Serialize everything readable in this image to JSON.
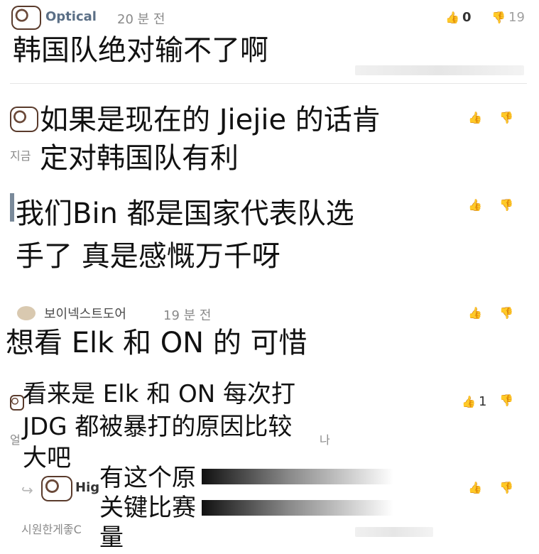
{
  "comments": [
    {
      "author": "Optical",
      "time": "20 분 전",
      "text": "韩国队绝对输不了啊",
      "likes": "0",
      "dislikes": "19"
    },
    {
      "text_line1": "如果是现在的 Jiejie 的话肯",
      "text_line2": "定对韩国队有利",
      "left_fragment": "지금"
    },
    {
      "text_line1": "我们Bin 都是国家代表队选",
      "text_line2": "手了 真是感慨万千呀"
    },
    {
      "author": "보이넥스트도어",
      "time": "19 분 전",
      "text": "想看 Elk 和 ON 的 可惜"
    },
    {
      "text_line1": "看来是 Elk 和 ON 每次打",
      "text_line2": "JDG 都被暴打的原因比较",
      "text_line3": "大吧",
      "likes": "1",
      "left_fragment": "얼",
      "right_fragment": "나"
    },
    {
      "author_fragment": "Hig",
      "text_line1": "有这个原",
      "text_line2": "关键比赛",
      "text_line3": "量",
      "footer_fragment": "시원한게좋C"
    }
  ]
}
